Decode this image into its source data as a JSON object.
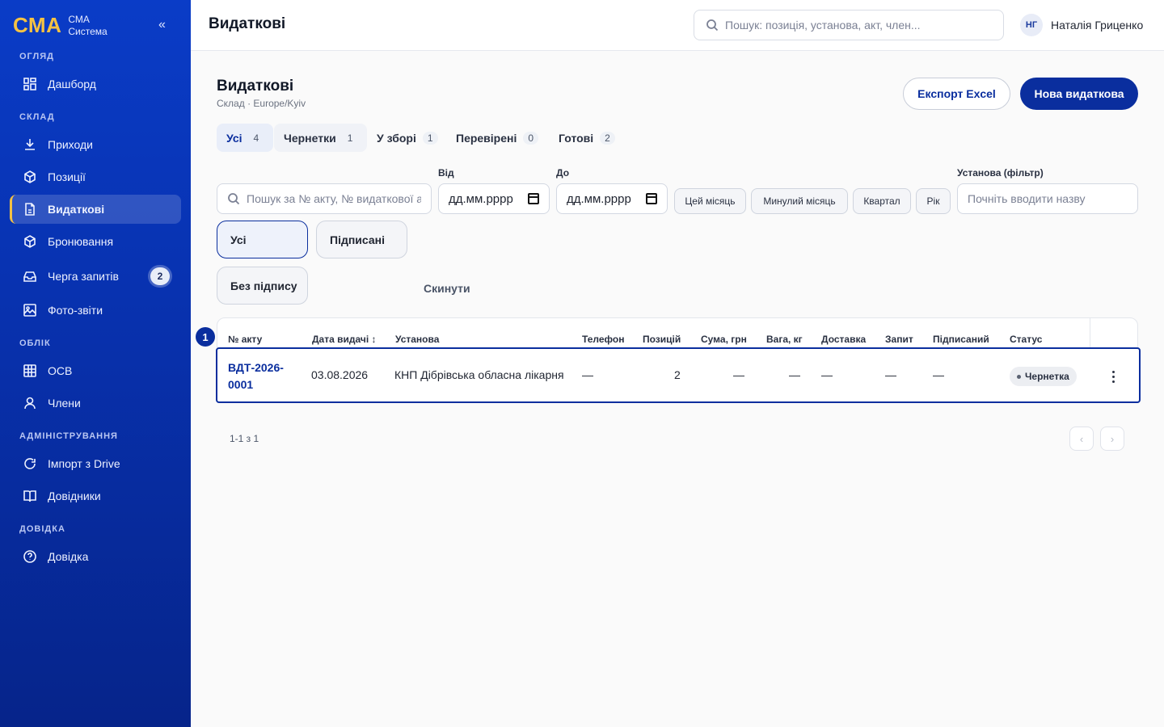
{
  "sidebar": {
    "brand_logo": "СМА",
    "brand_name": "СМА",
    "brand_sub": "Система",
    "collapse_label": "«",
    "sections": [
      {
        "title": "ОГЛЯД"
      },
      {
        "title": "СКЛАД"
      },
      {
        "title": "ОБЛІК"
      },
      {
        "title": "АДМІНІСТРУВАННЯ"
      },
      {
        "title": "ДОВІДКА"
      }
    ],
    "items": [
      {
        "label": "Дашборд",
        "icon": "dashboard-icon"
      },
      {
        "label": "Приходи",
        "icon": "download-icon"
      },
      {
        "label": "Позиції",
        "icon": "box-icon"
      },
      {
        "label": "Видаткові",
        "icon": "document-icon",
        "active": true
      },
      {
        "label": "Бронювання",
        "icon": "box-icon"
      },
      {
        "label": "Черга запитів",
        "icon": "inbox-icon",
        "badge": "2"
      },
      {
        "label": "Фото-звіти",
        "icon": "image-icon"
      },
      {
        "label": "ОСВ",
        "icon": "grid-icon"
      },
      {
        "label": "Члени",
        "icon": "user-icon"
      },
      {
        "label": "Імпорт з Drive",
        "icon": "refresh-icon"
      },
      {
        "label": "Довідники",
        "icon": "book-icon"
      },
      {
        "label": "Довідка",
        "icon": "help-icon"
      }
    ]
  },
  "topbar": {
    "title": "Видаткові",
    "search_placeholder": "Пошук: позиція, установа, акт, член...",
    "user_initials": "НГ",
    "user_name": "Наталія Гриценко"
  },
  "page": {
    "title": "Видаткові",
    "subtitle": "Склад · Europe/Kyiv",
    "export_label": "Експорт Excel",
    "new_label": "Нова видаткова"
  },
  "tabs": [
    {
      "label": "Усі",
      "count": "4"
    },
    {
      "label": "Чернетки",
      "count": "1"
    },
    {
      "label": "У зборі",
      "count": "1"
    },
    {
      "label": "Перевірені",
      "count": "0"
    },
    {
      "label": "Готові",
      "count": "2"
    }
  ],
  "filters": {
    "search_placeholder": "Пошук за № акту, № видаткової а",
    "from_label": "Від",
    "from_value": "дд.мм.рррр",
    "to_label": "До",
    "to_value": "дд.мм.рррр",
    "quick_ranges": [
      "Цей місяць",
      "Минулий місяць",
      "Квартал",
      "Рік"
    ],
    "institution_label": "Установа (фільтр)",
    "institution_placeholder": "Почніть вводити назву",
    "signature_options": [
      "Усі",
      "Підписані",
      "Без підпису"
    ],
    "reset_label": "Скинути"
  },
  "table": {
    "step_marker": "1",
    "columns": [
      "№ акту",
      "Дата видачі ↕",
      "Установа",
      "Телефон",
      "Позицій",
      "Сума, грн",
      "Вага, кг",
      "Доставка",
      "Запит",
      "Підписаний",
      "Статус"
    ],
    "rows": [
      {
        "act_line1": "ВДТ-2026-",
        "act_line2": "0001",
        "date": "03.08.2026",
        "institution": "КНП Дібрівська обласна лікарня",
        "phone": "—",
        "positions": "2",
        "sum": "—",
        "weight": "—",
        "delivery": "—",
        "request": "—",
        "signed": "—",
        "status": "Чернетка"
      }
    ]
  },
  "pagination": {
    "info": "1-1 з 1",
    "prev": "‹",
    "next": "›"
  },
  "colors": {
    "sidebar_top": "#0a3cc7",
    "sidebar_bottom": "#06248a",
    "accent": "#0a2e9e",
    "brand_yellow": "#f5c243"
  }
}
